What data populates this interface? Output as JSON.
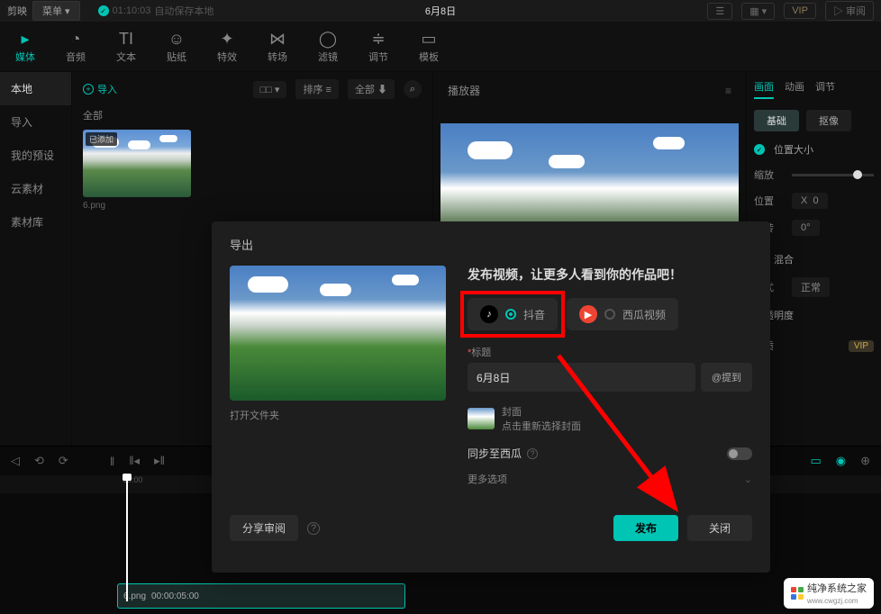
{
  "topbar": {
    "app_name": "剪映",
    "menu": "菜单 ▾",
    "autosave_time": "01:10:03",
    "autosave_text": "自动保存本地",
    "project_title": "6月8日",
    "vip": "VIP",
    "review": "审阅"
  },
  "tools": [
    {
      "icon": "▸",
      "label": "媒体",
      "active": true
    },
    {
      "icon": "◔",
      "label": "音频"
    },
    {
      "icon": "TI",
      "label": "文本"
    },
    {
      "icon": "☺",
      "label": "贴纸"
    },
    {
      "icon": "✦",
      "label": "特效"
    },
    {
      "icon": "⋈",
      "label": "转场"
    },
    {
      "icon": "◯",
      "label": "滤镜"
    },
    {
      "icon": "≑",
      "label": "调节"
    },
    {
      "icon": "▭",
      "label": "模板"
    }
  ],
  "sidebar": [
    {
      "label": "本地",
      "active": true
    },
    {
      "label": "导入"
    },
    {
      "label": "我的预设"
    },
    {
      "label": "云素材"
    },
    {
      "label": "素材库"
    }
  ],
  "media": {
    "import_label": "导入",
    "view_ctrl": "□□ ▾",
    "sort_ctrl": "排序 ≡",
    "filter_ctrl": "全部 ⬇",
    "all_label": "全部",
    "thumb": {
      "badge": "已添加",
      "name": "6.png"
    }
  },
  "player": {
    "title": "播放器"
  },
  "props": {
    "tabs": [
      "画面",
      "动画",
      "调节"
    ],
    "subtabs": [
      "基础",
      "抠像"
    ],
    "pos_size": "位置大小",
    "scale": "缩放",
    "position": "位置",
    "x_label": "X",
    "x_val": "0",
    "rotate": "旋转",
    "deg_val": "0°",
    "blend_label": "混合",
    "blend_mode_label": "模式",
    "blend_mode_val": "正常",
    "opacity_label": "不透明度",
    "quality_label": "画质",
    "quality_vip": "VIP"
  },
  "timeline": {
    "tick0": "00:00",
    "clip_name": "6.png",
    "clip_dur": "00:00:05:00"
  },
  "modal": {
    "title": "导出",
    "open_folder": "打开文件夹",
    "headline": "发布视频，让更多人看到你的作品吧！",
    "douyin": "抖音",
    "xigua": "西瓜视频",
    "title_label": "标题",
    "title_value": "6月8日",
    "mention": "@提到",
    "cover_label": "封面",
    "cover_hint": "点击重新选择封面",
    "sync_label": "同步至西瓜",
    "more_opt": "更多选项",
    "share_review": "分享审阅",
    "publish": "发布",
    "close": "关闭"
  },
  "watermark": {
    "text": "纯净系统之家",
    "url": "www.cwgzj.com"
  }
}
